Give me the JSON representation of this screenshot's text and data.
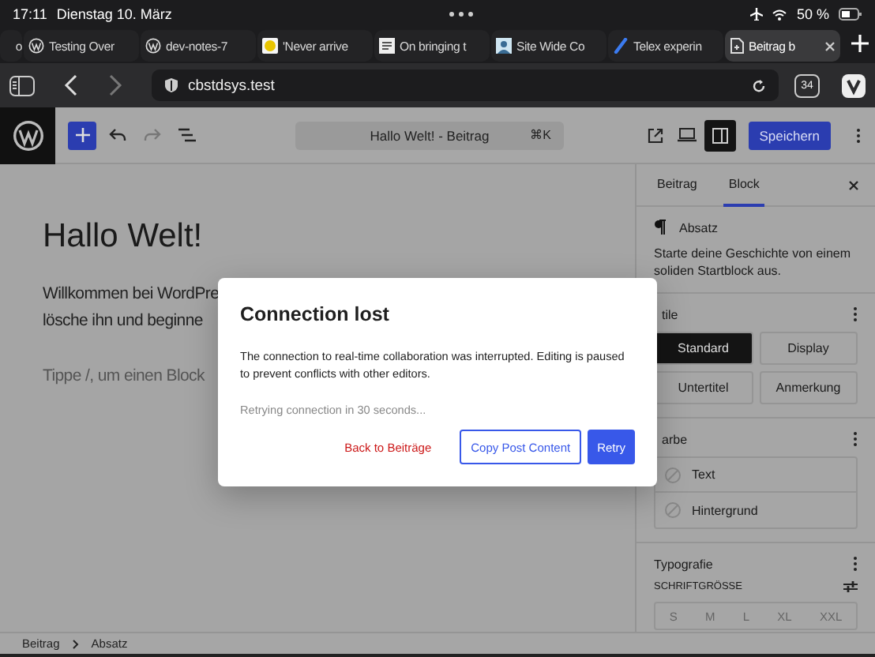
{
  "status_bar": {
    "time": "17:11",
    "date": "Dienstag 10. März",
    "battery": "50 %"
  },
  "browser_tabs": [
    {
      "label": "o",
      "selected": false
    },
    {
      "label": "Testing Over",
      "selected": false
    },
    {
      "label": "dev-notes-7",
      "selected": false
    },
    {
      "label": "'Never arrive",
      "selected": false
    },
    {
      "label": "On bringing t",
      "selected": false
    },
    {
      "label": "Site Wide Co",
      "selected": false
    },
    {
      "label": "Telex experin",
      "selected": false
    },
    {
      "label": "Beitrag b",
      "selected": true
    }
  ],
  "address_bar": {
    "url": "cbstdsys.test",
    "tab_count": "34"
  },
  "editor_toolbar": {
    "document_title": "Hallo Welt! - Beitrag",
    "shortcut": "⌘K",
    "save_label": "Speichern"
  },
  "content": {
    "title": "Hallo Welt!",
    "paragraph_lines": [
      "Willkommen bei WordPre",
      "lösche ihn und beginne"
    ],
    "placeholder": "Tippe /, um einen Block"
  },
  "sidebar": {
    "tabs": [
      {
        "label": "Beitrag",
        "selected": false
      },
      {
        "label": "Block",
        "selected": true
      }
    ],
    "block": {
      "name": "Absatz",
      "description": "Starte deine Geschichte von einem soliden Startblock aus."
    },
    "styles_heading": "tile",
    "styles": [
      {
        "label": "Standard",
        "selected": true
      },
      {
        "label": "Display",
        "selected": false
      },
      {
        "label": "Untertitel",
        "selected": false
      },
      {
        "label": "Anmerkung",
        "selected": false
      }
    ],
    "color_heading": "arbe",
    "colors": [
      "Text",
      "Hintergrund"
    ],
    "typography_heading": "Typografie",
    "font_size_label": "SCHRIFTGRÖSSE",
    "font_sizes": [
      "S",
      "M",
      "L",
      "XL",
      "XXL"
    ]
  },
  "breadcrumb": [
    "Beitrag",
    "Absatz"
  ],
  "dialog": {
    "title": "Connection lost",
    "message": "The connection to real-time collaboration was interrupted. Editing is paused to prevent conflicts with other editors.",
    "retry_note": "Retrying connection in 30 seconds...",
    "buttons": [
      {
        "label": "Back to Beiträge",
        "kind": "link"
      },
      {
        "label": "Copy Post Content",
        "kind": "secondary"
      },
      {
        "label": "Retry",
        "kind": "primary"
      }
    ]
  }
}
